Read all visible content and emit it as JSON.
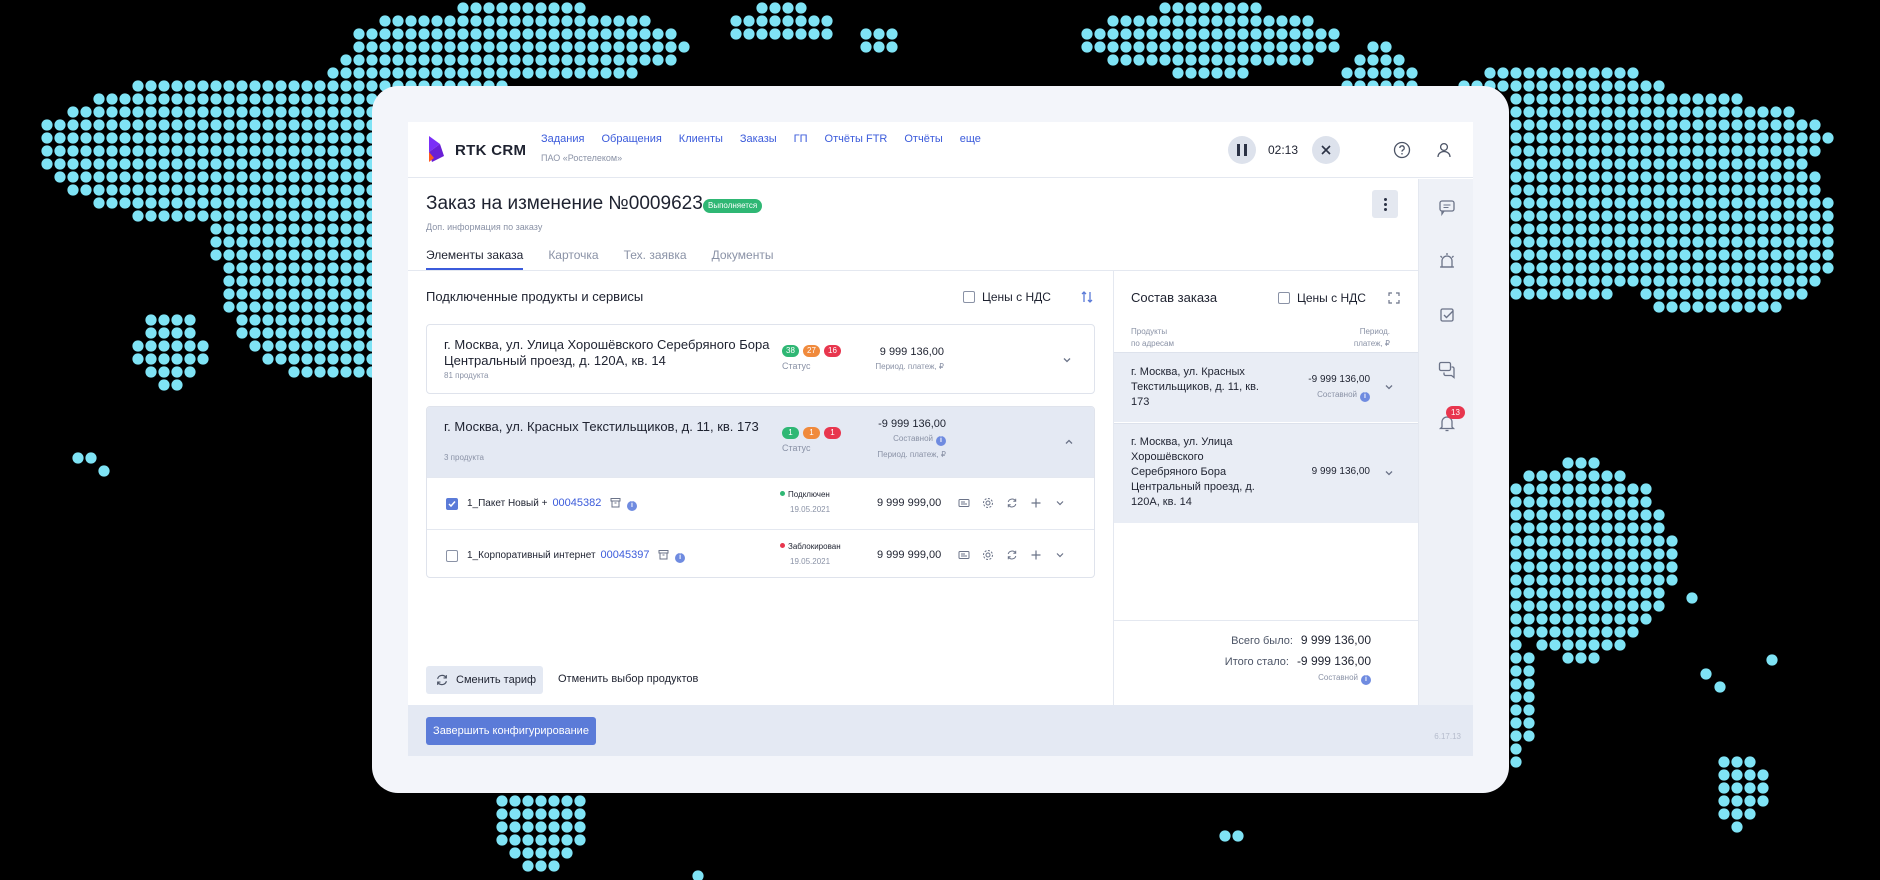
{
  "app": {
    "brand": "RTK CRM",
    "org": "ПАО «Ростелеком»",
    "nav": [
      "Задания",
      "Обращения",
      "Клиенты",
      "Заказы",
      "ГП",
      "Отчёты FTR",
      "Отчёты",
      "еще"
    ],
    "timer": "02:13",
    "notifications_count": "13"
  },
  "order": {
    "title": "Заказ на изменение №0009623",
    "status": "Выполняется",
    "subinfo": "Доп. информация по заказу",
    "tabs": [
      "Элементы заказа",
      "Карточка",
      "Тех. заявка",
      "Документы"
    ],
    "active_tab": 0
  },
  "left": {
    "title": "Подключенные продукты и сервисы",
    "vat_label": "Цены с НДС",
    "groups": [
      {
        "address": "г. Москва, ул. Улица Хорошёвского Серебряного Бора Центральный проезд, д. 120А, кв. 14",
        "count": "81 продукта",
        "pills": [
          "38",
          "27",
          "16"
        ],
        "status_label": "Статус",
        "amount": "9 999 136,00",
        "amount_label": "Период. платеж, ₽"
      },
      {
        "address": "г. Москва, ул. Красных Текстильщиков, д. 11, кв. 173",
        "count": "3 продукта",
        "pills": [
          "1",
          "1",
          "1"
        ],
        "status_label": "Статус",
        "amount": "-9 999 136,00",
        "amount_kind": "Составной",
        "amount_label": "Период. платеж, ₽"
      }
    ],
    "products": [
      {
        "name": "1_Пакет Новый +",
        "id": "00045382",
        "checked": true,
        "status": "Подключен",
        "status_color": "#2fb774",
        "date": "19.05.2021",
        "amount": "9 999 999,00"
      },
      {
        "name": "1_Корпоративный интернет",
        "id": "00045397",
        "checked": false,
        "status": "Заблокирован",
        "status_color": "#e8364e",
        "date": "19.05.2021",
        "amount": "9 999 999,00"
      }
    ],
    "btn_change_tariff": "Сменить тариф",
    "btn_cancel_selection": "Отменить выбор продуктов"
  },
  "right": {
    "title": "Состав заказа",
    "vat_label": "Цены с НДС",
    "col_products": [
      "Продукты",
      "по адресам"
    ],
    "col_period": [
      "Период.",
      "платеж, ₽"
    ],
    "rows": [
      {
        "address": [
          "г. Москва, ул. Красных",
          "Текстильщиков, д. 11, кв.",
          "173"
        ],
        "amount": "-9 999 136,00",
        "kind": "Составной"
      },
      {
        "address": [
          "г. Москва, ул. Улица",
          "Хорошёвского",
          "Серебряного Бора",
          "Центральный проезд, д.",
          "120А, кв. 14"
        ],
        "amount": "9 999 136,00"
      }
    ],
    "total_was_label": "Всего было:",
    "total_was": "9 999 136,00",
    "total_now_label": "Итого стало:",
    "total_now": "-9 999 136,00",
    "total_kind": "Составной"
  },
  "footer": {
    "btn_finish": "Завершить конфигурирование",
    "version": "6.17.13"
  },
  "colors": {
    "accent": "#3b5bdb",
    "primary_button": "#5b7bd8",
    "map_dots": "#7fe3f5",
    "success": "#2fb774",
    "warning": "#f08a3c",
    "danger": "#e8364e"
  },
  "icons": {
    "sidebar": [
      "comment-icon",
      "alarm-icon",
      "task-check-icon",
      "chat-icon",
      "bell-icon"
    ],
    "row_actions": [
      "card-icon",
      "settings-icon",
      "refresh-icon",
      "plus-icon",
      "chevron-down-icon"
    ]
  }
}
